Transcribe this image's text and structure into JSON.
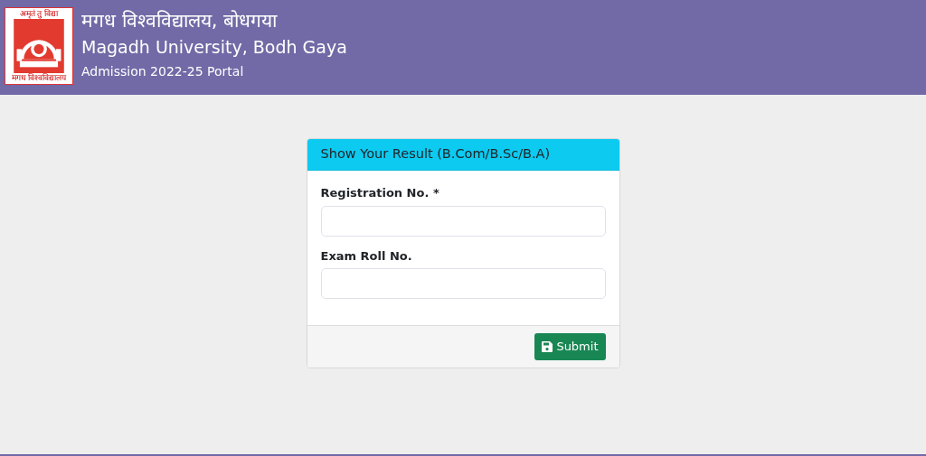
{
  "header": {
    "logo": {
      "top_text": "अमृतं तु विद्या",
      "bottom_text": "मगध विश्वविद्यालय"
    },
    "title_hindi": "मगध विश्वविद्यालय, बोधगया",
    "title": "Magadh University, Bodh Gaya",
    "subtitle": "Admission 2022-25 Portal"
  },
  "card": {
    "title": "Show Your Result (B.Com/B.Sc/B.A)",
    "fields": [
      {
        "label": "Registration No. *"
      },
      {
        "label": "Exam Roll No."
      }
    ],
    "button": "Submit"
  }
}
